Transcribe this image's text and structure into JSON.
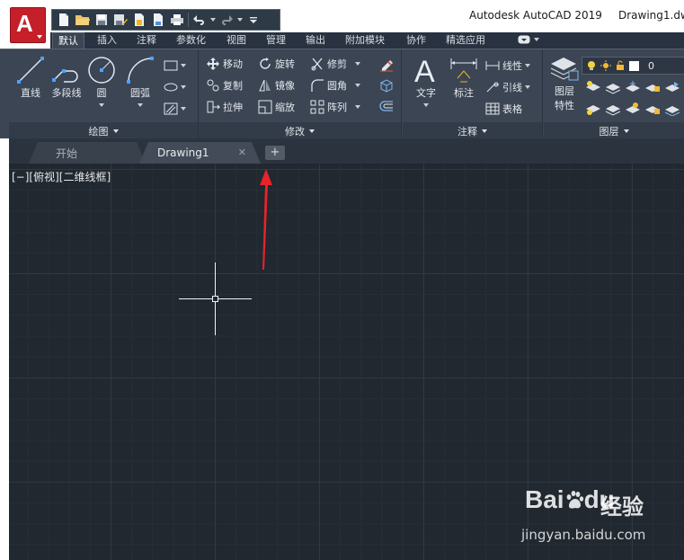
{
  "app": {
    "letter": "A",
    "title": "Autodesk AutoCAD 2019",
    "file_title": "Drawing1.dw"
  },
  "quick_access": {
    "icons": [
      "new-icon",
      "open-icon",
      "save-icon",
      "save-as-icon",
      "web-mobile-open-icon",
      "web-mobile-save-icon",
      "plot-icon",
      "undo-icon",
      "redo-icon",
      "customize-icon"
    ]
  },
  "ribbon_tabs": [
    "默认",
    "插入",
    "注释",
    "参数化",
    "视图",
    "管理",
    "输出",
    "附加模块",
    "协作",
    "精选应用"
  ],
  "ribbon_tab_active": "默认",
  "panels": {
    "draw": {
      "title": "绘图",
      "line": "直线",
      "polyline": "多段线",
      "circle": "圆",
      "arc": "圆弧"
    },
    "modify": {
      "title": "修改",
      "move": "移动",
      "rotate": "旋转",
      "trim": "修剪",
      "copy": "复制",
      "mirror": "镜像",
      "fillet": "圆角",
      "stretch": "拉伸",
      "scale": "缩放",
      "array": "阵列"
    },
    "annotation": {
      "title": "注释",
      "text": "文字",
      "dimension": "标注",
      "linear": "线性",
      "leader": "引线",
      "table": "表格"
    },
    "layers": {
      "title": "图层",
      "properties_line1": "图层",
      "properties_line2": "特性",
      "current_layer": "0"
    }
  },
  "file_tabs": {
    "start": "开始",
    "drawing": "Drawing1",
    "close": "✕",
    "add": "+"
  },
  "viewport": {
    "label": "[−][俯视][二维线框]"
  },
  "watermark": {
    "brand_latin": "Bai",
    "brand_du": "du",
    "brand_cn": "经验",
    "url": "jingyan.baidu.com"
  },
  "colors": {
    "accent_red": "#c5202a",
    "ribbon_bg": "#3b4554",
    "canvas_bg": "#212830",
    "annotation_arrow": "#e8232a"
  }
}
